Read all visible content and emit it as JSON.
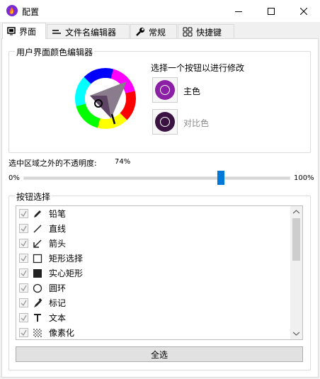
{
  "window": {
    "title": "配置"
  },
  "tabs": [
    {
      "label": "界面",
      "active": true,
      "icon": "monitor-icon"
    },
    {
      "label": "文件名编辑器",
      "active": false,
      "icon": "text-field-icon"
    },
    {
      "label": "常规",
      "active": false,
      "icon": "wrench-icon"
    },
    {
      "label": "快捷键",
      "active": false,
      "icon": "grid-icon"
    }
  ],
  "color_editor": {
    "group_title": "用户界面颜色编辑器",
    "prompt": "选择一个按钮以进行修改",
    "main_color_label": "主色",
    "main_color": "#8b1fa6",
    "contrast_color_label": "对比色",
    "contrast_color": "#3a1342"
  },
  "opacity": {
    "label": "选中区域之外的不透明度:",
    "value_text": "74%",
    "value": 74,
    "min_label": "0%",
    "max_label": "100%"
  },
  "buttons_group": {
    "title": "按钮选择",
    "items": [
      {
        "label": "铅笔",
        "icon": "pencil-icon",
        "checked": true
      },
      {
        "label": "直线",
        "icon": "line-icon",
        "checked": true
      },
      {
        "label": "箭头",
        "icon": "arrow-icon",
        "checked": true
      },
      {
        "label": "矩形选择",
        "icon": "rectangle-outline-icon",
        "checked": true
      },
      {
        "label": "实心矩形",
        "icon": "filled-rectangle-icon",
        "checked": true
      },
      {
        "label": "圆环",
        "icon": "circle-icon",
        "checked": true
      },
      {
        "label": "标记",
        "icon": "marker-icon",
        "checked": true
      },
      {
        "label": "文本",
        "icon": "text-icon",
        "checked": true
      },
      {
        "label": "像素化",
        "icon": "pixelate-icon",
        "checked": true
      }
    ],
    "select_all_label": "全选"
  }
}
